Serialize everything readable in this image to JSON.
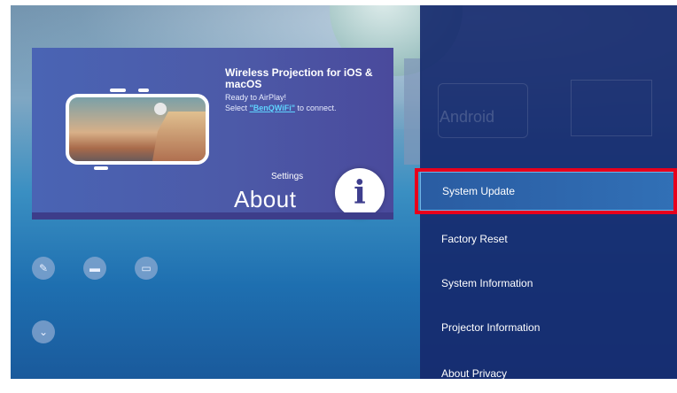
{
  "card": {
    "title": "Wireless Projection for iOS & macOS",
    "line1": "Ready to AirPlay!",
    "line2_prefix": "Select ",
    "line2_link": "\"BenQWiFi\"",
    "line2_suffix": " to connect.",
    "settings_label": "Settings",
    "about_label": "About",
    "info_glyph": "i"
  },
  "apps": [
    {
      "icon": "pencil-icon",
      "glyph": "✎"
    },
    {
      "icon": "hdmi-icon",
      "glyph": "▬"
    },
    {
      "icon": "input-source-icon",
      "glyph": "▭"
    },
    {
      "icon": "down-arrow-icon",
      "glyph": "⌄"
    }
  ],
  "panel": {
    "background_app": "Android",
    "menu": [
      {
        "label": "System Update",
        "selected": true
      },
      {
        "label": "Factory Reset",
        "selected": false
      },
      {
        "label": "System Information",
        "selected": false
      },
      {
        "label": "Projector Information",
        "selected": false
      },
      {
        "label": "About Privacy",
        "selected": false
      }
    ]
  },
  "colors": {
    "highlight": "#e8001c",
    "link": "#5fd3ff",
    "panel": "#162a6e"
  }
}
